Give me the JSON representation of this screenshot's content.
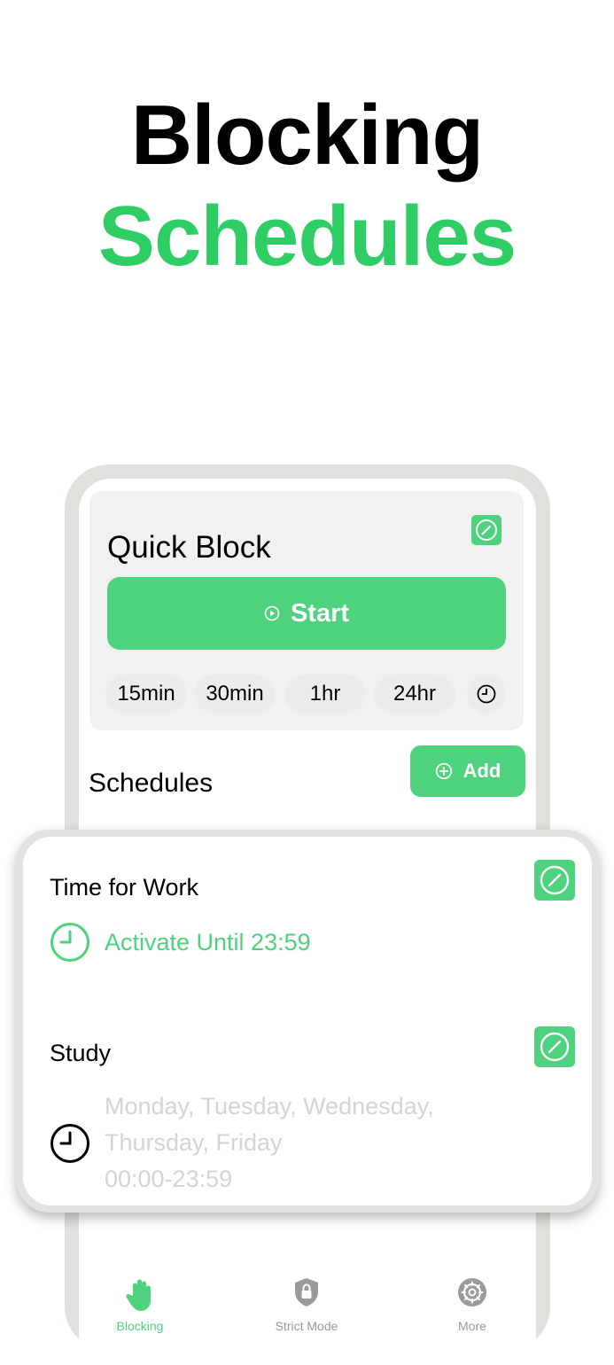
{
  "hero": {
    "line1": "Blocking",
    "line2": "Schedules"
  },
  "colors": {
    "accent": "#4fd27d",
    "hero_green": "#2fce64",
    "muted_text": "#d4d4d4",
    "card_bg": "#f1f1f1",
    "frame": "#e1e0dc"
  },
  "quick_block": {
    "title": "Quick Block",
    "start_label": "Start",
    "durations": [
      "15min",
      "30min",
      "1hr",
      "24hr"
    ]
  },
  "schedules_section": {
    "title": "Schedules",
    "add_label": "Add"
  },
  "schedules": [
    {
      "name": "Time for Work",
      "status": "Activate Until 23:59"
    },
    {
      "name": "Study",
      "days_line1": "Monday, Tuesday, Wednesday,",
      "days_line2": "Thursday, Friday",
      "time_range": "00:00-23:59"
    }
  ],
  "tabs": [
    {
      "label": "Blocking",
      "icon": "hand-icon",
      "active": true
    },
    {
      "label": "Strict Mode",
      "icon": "shield-lock-icon",
      "active": false
    },
    {
      "label": "More",
      "icon": "gear-icon",
      "active": false
    }
  ]
}
